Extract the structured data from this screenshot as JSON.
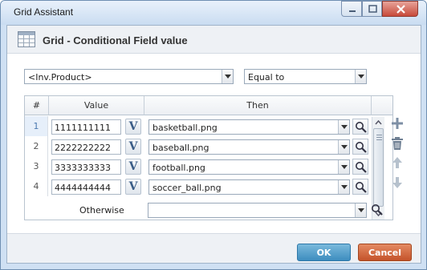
{
  "window": {
    "title": "Grid Assistant"
  },
  "header": {
    "title": "Grid - Conditional Field value",
    "icon": "grid-icon"
  },
  "condition": {
    "field": "<Inv.Product>",
    "operator": "Equal to"
  },
  "grid": {
    "columns": {
      "num": "#",
      "value": "Value",
      "then": "Then"
    },
    "rows": [
      {
        "num": "1",
        "value": "1111111111",
        "then": "basketball.png"
      },
      {
        "num": "2",
        "value": "2222222222",
        "then": "baseball.png"
      },
      {
        "num": "3",
        "value": "3333333333",
        "then": "football.png"
      },
      {
        "num": "4",
        "value": "4444444444",
        "then": "soccer_ball.png"
      }
    ],
    "v_label": "V"
  },
  "otherwise": {
    "label": "Otherwise",
    "value": ""
  },
  "footer": {
    "ok": "OK",
    "cancel": "Cancel"
  },
  "colors": {
    "ok": "#4a99c9",
    "cancel": "#d2653a",
    "selected_row": "#e6effa"
  }
}
